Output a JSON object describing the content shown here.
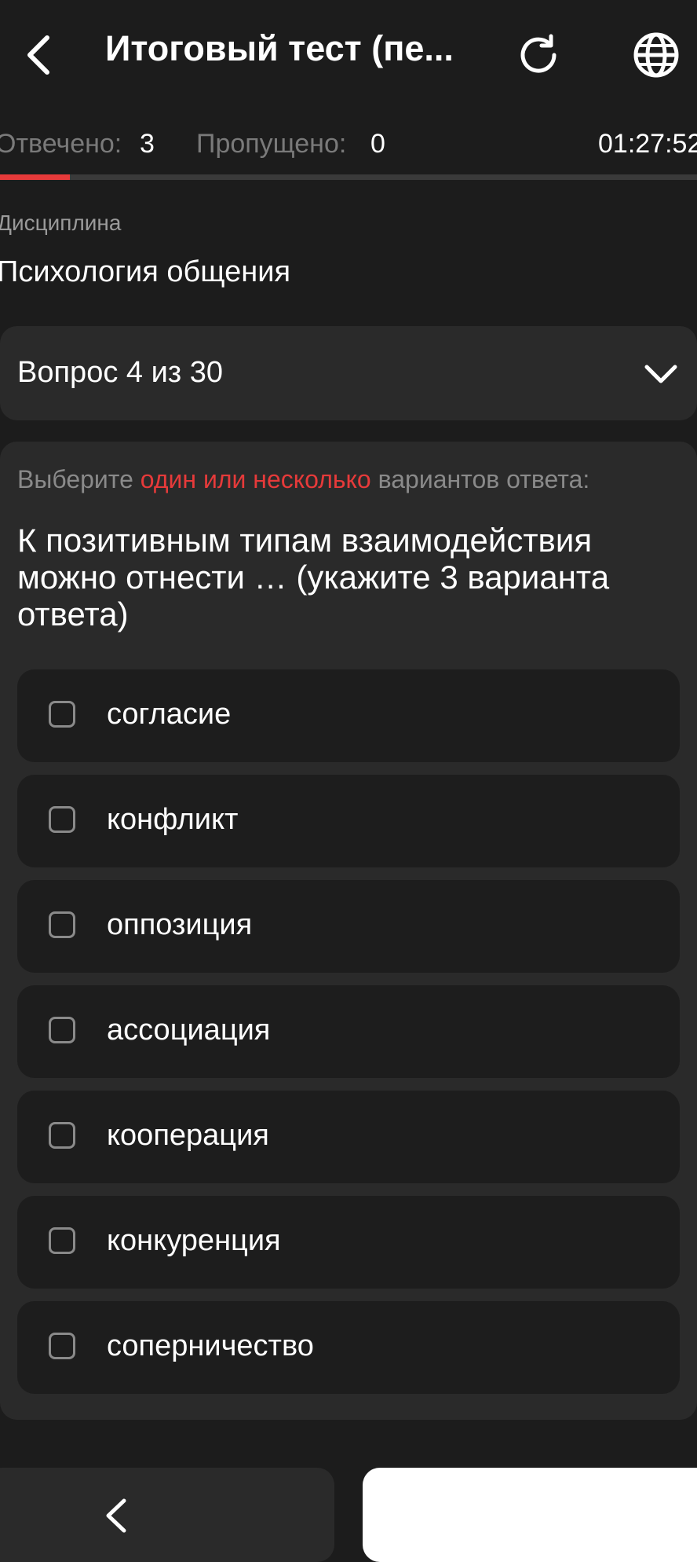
{
  "header": {
    "title": "Итоговый тест (пе...",
    "back_icon": "back-arrow-icon",
    "refresh_icon": "refresh-icon",
    "language_icon": "globe-icon"
  },
  "stats": {
    "answered_label": "Отвечено:",
    "answered_value": "3",
    "skipped_label": "Пропущено:",
    "skipped_value": "0",
    "timer": "01:27:52"
  },
  "progress": {
    "fraction": 0.1,
    "fill_color": "#e63a3a"
  },
  "discipline": {
    "label": "Дисциплина",
    "value": "Психология общения"
  },
  "question_selector": {
    "label": "Вопрос 4 из 30",
    "icon": "chevron-down-icon"
  },
  "question": {
    "hint_before": "Выберите",
    "hint_accent": "один или несколько",
    "hint_after": "вариантов ответа:",
    "text": "К позитивным типам взаимодействия можно отнести … (укажите 3 варианта ответа)",
    "options": [
      {
        "label": "согласие",
        "checked": false
      },
      {
        "label": "конфликт",
        "checked": false
      },
      {
        "label": "оппозиция",
        "checked": false
      },
      {
        "label": "ассоциация",
        "checked": false
      },
      {
        "label": "кооперация",
        "checked": false
      },
      {
        "label": "конкуренция",
        "checked": false
      },
      {
        "label": "соперничество",
        "checked": false
      }
    ]
  },
  "colors": {
    "background": "#1c1c1c",
    "card": "#2a2a2a",
    "accent": "#e63a3a"
  }
}
